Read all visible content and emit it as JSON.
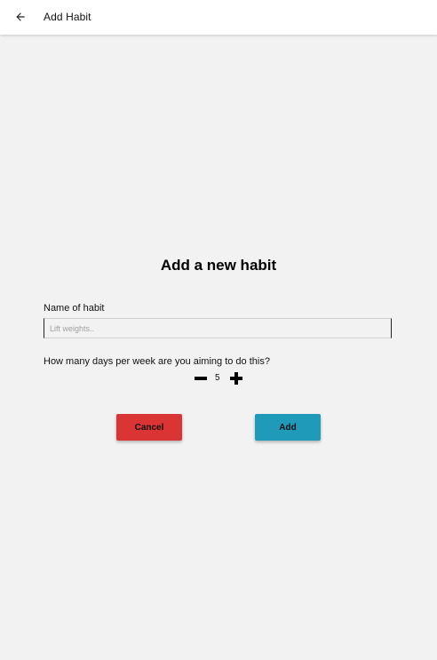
{
  "app_bar": {
    "back_icon": "arrow-left-icon",
    "title": "Add Habit"
  },
  "form": {
    "heading": "Add a new habit",
    "name_label": "Name of habit",
    "name_value": "",
    "name_placeholder": "Lift weights..",
    "days_question": "How many days per week are you aiming to do this?",
    "days_value": "5",
    "decrement_icon": "minus-icon",
    "increment_icon": "plus-icon"
  },
  "actions": {
    "cancel_label": "Cancel",
    "add_label": "Add",
    "cancel_color": "#db3434",
    "add_color": "#1f9ab9"
  },
  "colors": {
    "background": "#f2f2f2",
    "app_bar": "#ffffff"
  }
}
